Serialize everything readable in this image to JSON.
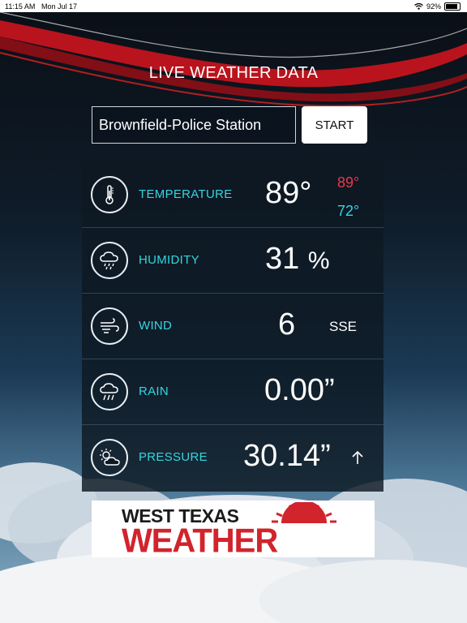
{
  "status_bar": {
    "time": "11:15 AM",
    "date": "Mon Jul 17",
    "battery": "92%",
    "battery_level": 0.92
  },
  "header": {
    "title": "LIVE WEATHER DATA"
  },
  "station": {
    "value": "Brownfield-Police Station"
  },
  "start_button": {
    "label": "START"
  },
  "rows": {
    "temperature": {
      "label": "TEMPERATURE",
      "value": "89°",
      "high": "89°",
      "low": "72°",
      "icon": "thermometer-icon"
    },
    "humidity": {
      "label": "HUMIDITY",
      "value": "31",
      "unit": "%",
      "icon": "cloud-rain-icon"
    },
    "wind": {
      "label": "WIND",
      "value": "6",
      "direction": "SSE",
      "icon": "wind-icon"
    },
    "rain": {
      "label": "RAIN",
      "value": "0.00”",
      "icon": "cloud-rain-icon"
    },
    "pressure": {
      "label": "PRESSURE",
      "value": "30.14”",
      "trend": "up",
      "icon": "sun-cloud-icon"
    }
  },
  "logo": {
    "line1": "WEST TEXAS",
    "line2": "WEATHER"
  },
  "colors": {
    "accent_cyan": "#34d6e0",
    "high_red": "#e9384b",
    "panel": "#0e1822",
    "logo_red": "#d1242c"
  }
}
